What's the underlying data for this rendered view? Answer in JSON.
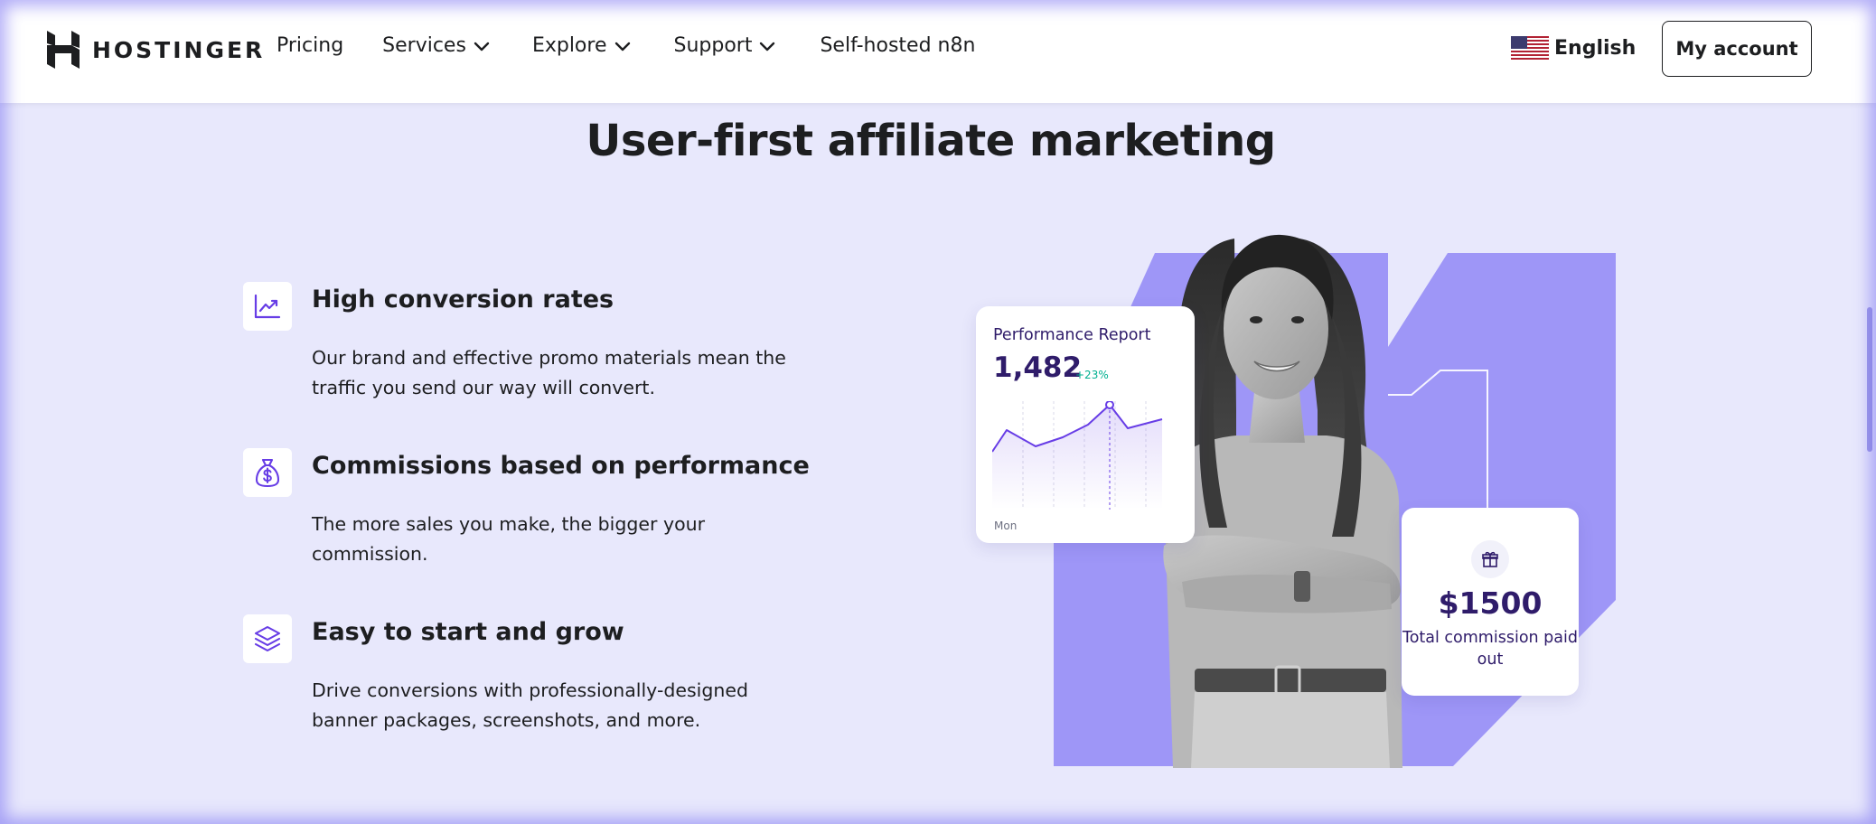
{
  "header": {
    "logo_text": "HOSTINGER",
    "nav": [
      {
        "label": "Pricing"
      },
      {
        "label": "Services"
      },
      {
        "label": "Explore"
      },
      {
        "label": "Support"
      },
      {
        "label": "Self-hosted n8n"
      }
    ],
    "language": "English",
    "account_label": "My account"
  },
  "section": {
    "title": "User-first affiliate marketing",
    "features": [
      {
        "title": "High conversion rates",
        "desc": "Our brand and effective promo materials mean the traffic you send our way will convert.",
        "icon": "trend-up-icon"
      },
      {
        "title": "Commissions based on performance",
        "desc": "The more sales you make, the bigger your commission.",
        "icon": "money-bag-icon"
      },
      {
        "title": "Easy to start and grow",
        "desc": "Drive conversions with professionally-designed banner packages, screenshots, and more.",
        "icon": "layers-icon"
      }
    ]
  },
  "performance_card": {
    "title": "Performance Report",
    "value": "1,482",
    "delta": "+23%",
    "day_label": "Mon"
  },
  "commission_card": {
    "value": "$1500",
    "label": "Total commission paid out"
  },
  "colors": {
    "page_bg": "#E8E8FC",
    "accent": "#673DE6",
    "shape": "#9E96F7",
    "text_dark": "#1D1E20",
    "card_text": "#2F1C6A",
    "positive": "#00B090"
  }
}
